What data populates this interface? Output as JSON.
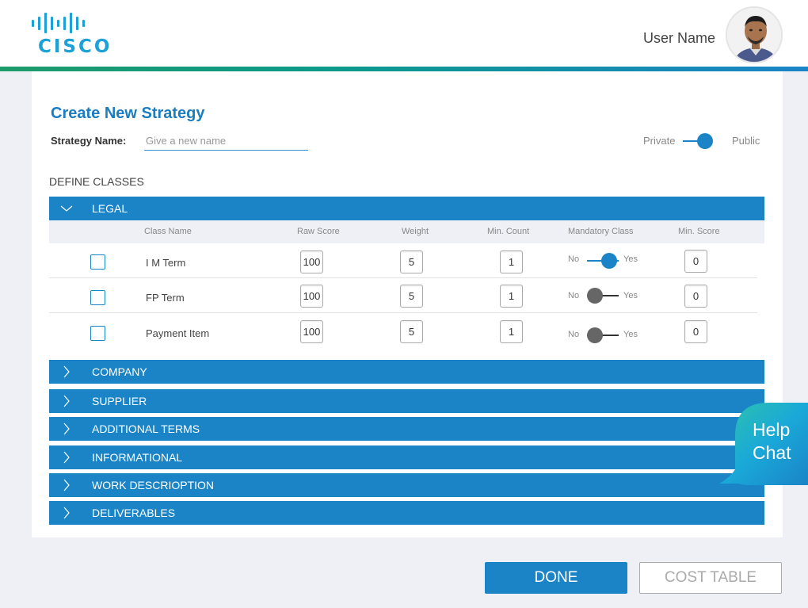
{
  "header": {
    "logo_text": "CISCO",
    "user_name": "User Name"
  },
  "strategy": {
    "title": "Create New Strategy",
    "name_label": "Strategy Name:",
    "name_placeholder": "Give a new name",
    "name_value": "",
    "visibility": {
      "left_label": "Private",
      "right_label": "Public",
      "selected": "Public"
    }
  },
  "define_label": "DEFINE CLASSES",
  "sections": [
    {
      "label": "LEGAL",
      "expanded": true
    },
    {
      "label": "COMPANY",
      "expanded": false
    },
    {
      "label": "SUPPLIER",
      "expanded": false
    },
    {
      "label": "ADDITIONAL TERMS",
      "expanded": false
    },
    {
      "label": "INFORMATIONAL",
      "expanded": false
    },
    {
      "label": "WORK DESCRIOPTION",
      "expanded": false
    },
    {
      "label": "DELIVERABLES",
      "expanded": false
    }
  ],
  "table": {
    "columns": [
      "Class Name",
      "Raw Score",
      "Weight",
      "Min. Count",
      "Mandatory Class",
      "Min. Score"
    ],
    "toggle_no": "No",
    "toggle_yes": "Yes",
    "rows": [
      {
        "name": "I M Term",
        "raw_score": "100",
        "weight": "5",
        "min_count": "1",
        "mandatory": true,
        "min_score": "0",
        "checked": false
      },
      {
        "name": "FP Term",
        "raw_score": "100",
        "weight": "5",
        "min_count": "1",
        "mandatory": false,
        "min_score": "0",
        "checked": false
      },
      {
        "name": "Payment Item",
        "raw_score": "100",
        "weight": "5",
        "min_count": "1",
        "mandatory": false,
        "min_score": "0",
        "checked": false
      }
    ]
  },
  "buttons": {
    "done": "DONE",
    "cost_table": "COST TABLE"
  },
  "help_chat": {
    "line1": "Help",
    "line2": "Chat"
  },
  "colors": {
    "primary": "#1a84c7",
    "logo": "#1ba0d7",
    "background": "#eef0f6"
  }
}
